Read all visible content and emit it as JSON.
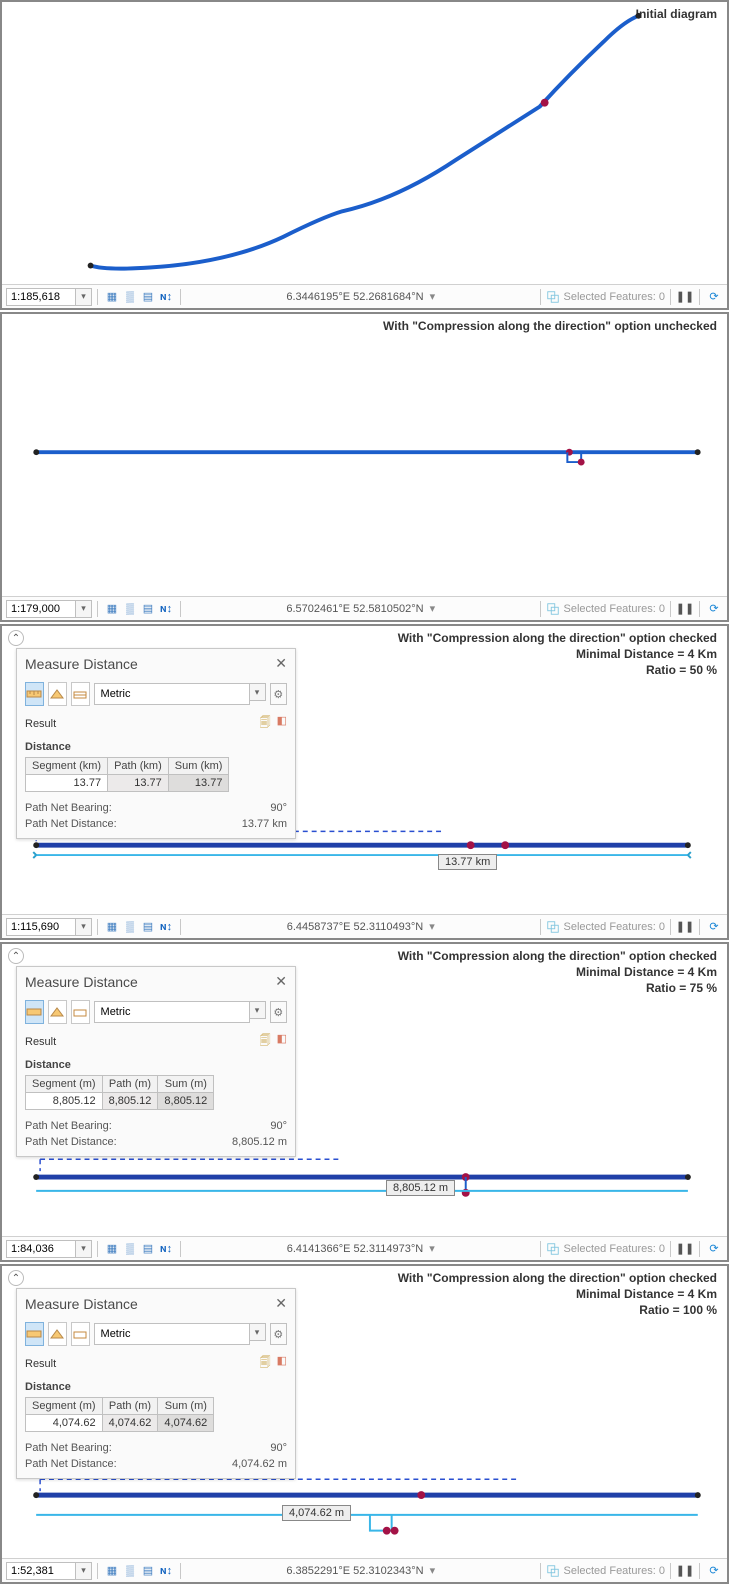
{
  "panels": [
    {
      "title": "Initial diagram",
      "scale": "1:185,618",
      "coords": "6.3446195°E 52.2681684°N",
      "selected": "Selected Features: 0"
    },
    {
      "title": "With \"Compression along the direction\" option unchecked",
      "scale": "1:179,000",
      "coords": "6.5702461°E 52.5810502°N",
      "selected": "Selected Features: 0"
    },
    {
      "title": [
        "With \"Compression along the direction\" option checked",
        "Minimal Distance = 4 Km",
        "Ratio = 50 %"
      ],
      "scale": "1:115,690",
      "coords": "6.4458737°E 52.3110493°N",
      "selected": "Selected Features: 0",
      "measure": {
        "title": "Measure Distance",
        "unit": "Metric",
        "result_label": "Result",
        "distance_label": "Distance",
        "cols": [
          "Segment (km)",
          "Path (km)",
          "Sum (km)"
        ],
        "vals": [
          "13.77",
          "13.77",
          "13.77"
        ],
        "bearing_label": "Path Net Bearing:",
        "bearing": "90°",
        "netdist_label": "Path Net Distance:",
        "netdist": "13.77 km"
      },
      "meas_text": "13.77 km"
    },
    {
      "title": [
        "With \"Compression along the direction\" option checked",
        "Minimal Distance = 4 Km",
        "Ratio = 75 %"
      ],
      "scale": "1:84,036",
      "coords": "6.4141366°E 52.3114973°N",
      "selected": "Selected Features: 0",
      "measure": {
        "title": "Measure Distance",
        "unit": "Metric",
        "result_label": "Result",
        "distance_label": "Distance",
        "cols": [
          "Segment (m)",
          "Path (m)",
          "Sum (m)"
        ],
        "vals": [
          "8,805.12",
          "8,805.12",
          "8,805.12"
        ],
        "bearing_label": "Path Net Bearing:",
        "bearing": "90°",
        "netdist_label": "Path Net Distance:",
        "netdist": "8,805.12 m"
      },
      "meas_text": "8,805.12 m"
    },
    {
      "title": [
        "With \"Compression along the direction\" option checked",
        "Minimal Distance = 4 Km",
        "Ratio = 100 %"
      ],
      "scale": "1:52,381",
      "coords": "6.3852291°E 52.3102343°N",
      "selected": "Selected Features: 0",
      "measure": {
        "title": "Measure Distance",
        "unit": "Metric",
        "result_label": "Result",
        "distance_label": "Distance",
        "cols": [
          "Segment (m)",
          "Path (m)",
          "Sum (m)"
        ],
        "vals": [
          "4,074.62",
          "4,074.62",
          "4,074.62"
        ],
        "bearing_label": "Path Net Bearing:",
        "bearing": "90°",
        "netdist_label": "Path Net Distance:",
        "netdist": "4,074.62 m"
      },
      "meas_text": "4,074.62 m"
    }
  ],
  "chart_data": [
    {
      "type": "line",
      "title": "Initial diagram"
    },
    {
      "type": "line",
      "title": "Compression unchecked"
    },
    {
      "type": "line",
      "title": "Compression checked 50%",
      "measured_km": 13.77
    },
    {
      "type": "line",
      "title": "Compression checked 75%",
      "measured_m": 8805.12
    },
    {
      "type": "line",
      "title": "Compression checked 100%",
      "measured_m": 4074.62
    }
  ]
}
